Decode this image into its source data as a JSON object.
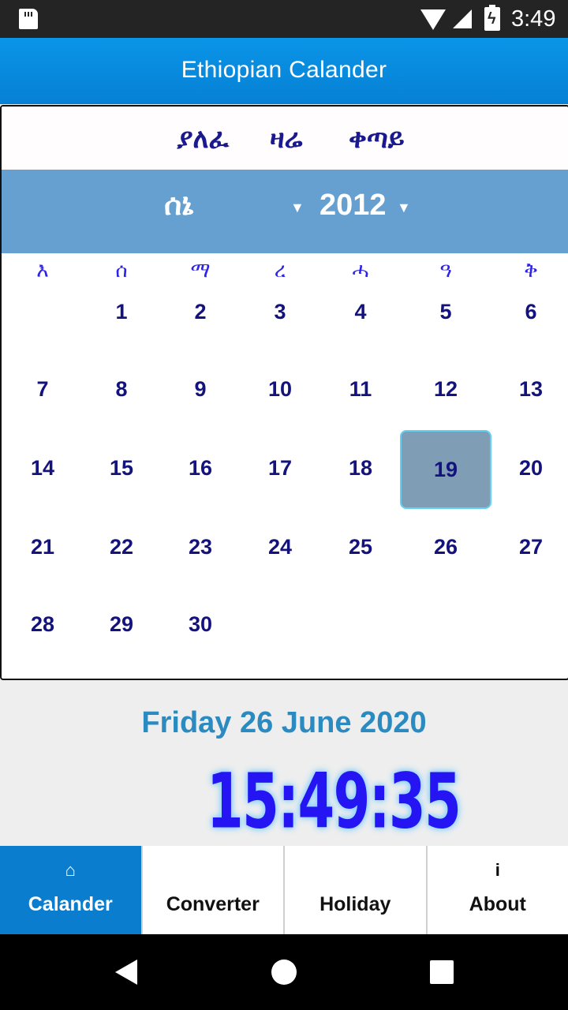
{
  "status_bar": {
    "time": "3:49",
    "icons": [
      "sd-card-icon",
      "wifi-icon",
      "cell-signal-icon",
      "battery-charging-icon"
    ]
  },
  "app_bar": {
    "title": "Ethiopian Calander"
  },
  "calendar": {
    "nav": {
      "previous": "ያለፈ",
      "today": "ዛሬ",
      "next": "ቀጣይ"
    },
    "month_select": {
      "value": "ሰኔ"
    },
    "year_select": {
      "value": "2012"
    },
    "weekdays": [
      "እ",
      "ሰ",
      "ማ",
      "ረ",
      "ሓ",
      "ዓ",
      "ቅ"
    ],
    "first_weekday_index": 1,
    "days_in_month": 30,
    "selected_day": 19,
    "days": [
      "1",
      "2",
      "3",
      "4",
      "5",
      "6",
      "7",
      "8",
      "9",
      "10",
      "11",
      "12",
      "13",
      "14",
      "15",
      "16",
      "17",
      "18",
      "19",
      "20",
      "21",
      "22",
      "23",
      "24",
      "25",
      "26",
      "27",
      "28",
      "29",
      "30"
    ]
  },
  "gregorian_date": "Friday 26 June 2020",
  "current_time": "15:49:35",
  "bottom_nav": {
    "tabs": [
      {
        "label": "Calander",
        "icon": "home-icon",
        "active": true
      },
      {
        "label": "Converter",
        "icon": "",
        "active": false
      },
      {
        "label": "Holiday",
        "icon": "",
        "active": false
      },
      {
        "label": "About",
        "icon": "info-icon",
        "active": false
      }
    ]
  },
  "colors": {
    "app_bar": "#0a8de0",
    "picker_bg": "#65a0d0",
    "day_text": "#14137e",
    "weekday_text": "#2d22e8",
    "selected_bg": "#7f9db5",
    "selected_border": "#63d1f3",
    "gregorian_text": "#2b8bc0",
    "time_text": "#2515f2",
    "active_tab": "#0b7dcf"
  }
}
